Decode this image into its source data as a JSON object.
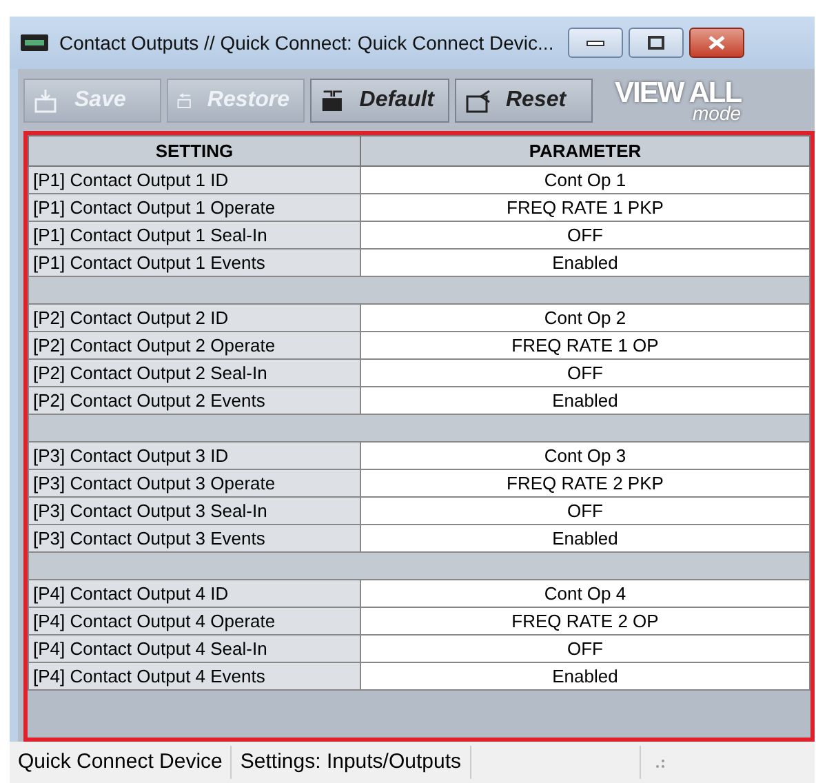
{
  "window": {
    "title": "Contact Outputs // Quick Connect: Quick Connect Devic..."
  },
  "toolbar": [
    {
      "label": "Save",
      "disabled": true,
      "kind": "save"
    },
    {
      "label": "Restore",
      "disabled": true,
      "kind": "restore"
    },
    {
      "label": "Default",
      "disabled": false,
      "kind": "default"
    },
    {
      "label": "Reset",
      "disabled": false,
      "kind": "reset"
    }
  ],
  "mode": {
    "title": "VIEW ALL",
    "subtitle": "mode"
  },
  "table": {
    "columns": [
      "SETTING",
      "PARAMETER"
    ],
    "groups": [
      {
        "rows": [
          {
            "setting": "[P1] Contact Output 1 ID",
            "parameter": "Cont Op 1"
          },
          {
            "setting": "[P1] Contact Output 1 Operate",
            "parameter": "FREQ RATE 1 PKP"
          },
          {
            "setting": "[P1] Contact Output 1 Seal-In",
            "parameter": "OFF"
          },
          {
            "setting": "[P1] Contact Output 1 Events",
            "parameter": "Enabled"
          }
        ]
      },
      {
        "rows": [
          {
            "setting": "[P2] Contact Output 2 ID",
            "parameter": "Cont Op 2"
          },
          {
            "setting": "[P2] Contact Output 2 Operate",
            "parameter": "FREQ RATE 1 OP"
          },
          {
            "setting": "[P2] Contact Output 2 Seal-In",
            "parameter": "OFF"
          },
          {
            "setting": "[P2] Contact Output 2 Events",
            "parameter": "Enabled"
          }
        ]
      },
      {
        "rows": [
          {
            "setting": "[P3] Contact Output 3 ID",
            "parameter": "Cont Op 3"
          },
          {
            "setting": "[P3] Contact Output 3 Operate",
            "parameter": "FREQ RATE 2 PKP"
          },
          {
            "setting": "[P3] Contact Output 3 Seal-In",
            "parameter": "OFF"
          },
          {
            "setting": "[P3] Contact Output 3 Events",
            "parameter": "Enabled"
          }
        ]
      },
      {
        "rows": [
          {
            "setting": "[P4] Contact Output 4 ID",
            "parameter": "Cont Op 4"
          },
          {
            "setting": "[P4] Contact Output 4 Operate",
            "parameter": "FREQ RATE 2 OP"
          },
          {
            "setting": "[P4] Contact Output 4 Seal-In",
            "parameter": "OFF"
          },
          {
            "setting": "[P4] Contact Output 4 Events",
            "parameter": "Enabled"
          }
        ]
      }
    ]
  },
  "status_bar": [
    "Quick Connect Device",
    "Settings: Inputs/Outputs"
  ]
}
